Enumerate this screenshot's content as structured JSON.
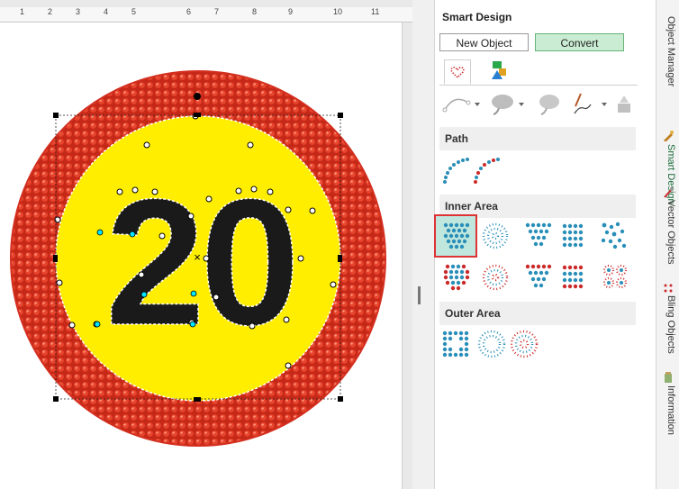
{
  "ruler": {
    "labels": [
      "1",
      "2",
      "3",
      "4",
      "5",
      "6",
      "7",
      "8",
      "9",
      "10",
      "11"
    ]
  },
  "sign": {
    "number": "20",
    "ring_color": "#d32f1f",
    "inner_color": "#ffee00",
    "digit_color": "#1a1a1a"
  },
  "panel": {
    "title": "Smart Design",
    "new_object_label": "New Object",
    "convert_label": "Convert",
    "sections": {
      "path": "Path",
      "inner_area": "Inner Area",
      "outer_area": "Outer Area"
    }
  },
  "side_tabs": [
    {
      "label": "Object Manager",
      "icon": "object-manager-icon"
    },
    {
      "label": "Smart Design",
      "icon": "smart-design-icon"
    },
    {
      "label": "Vector Objects",
      "icon": "vector-objects-icon"
    },
    {
      "label": "Bling Objects",
      "icon": "bling-objects-icon"
    },
    {
      "label": "Information",
      "icon": "information-icon"
    }
  ],
  "colors": {
    "accent": "#c9ecd2",
    "selection": "#d33333",
    "rhinestone_blue": "#3a9ec2",
    "rhinestone_red": "#cc2a2a"
  }
}
